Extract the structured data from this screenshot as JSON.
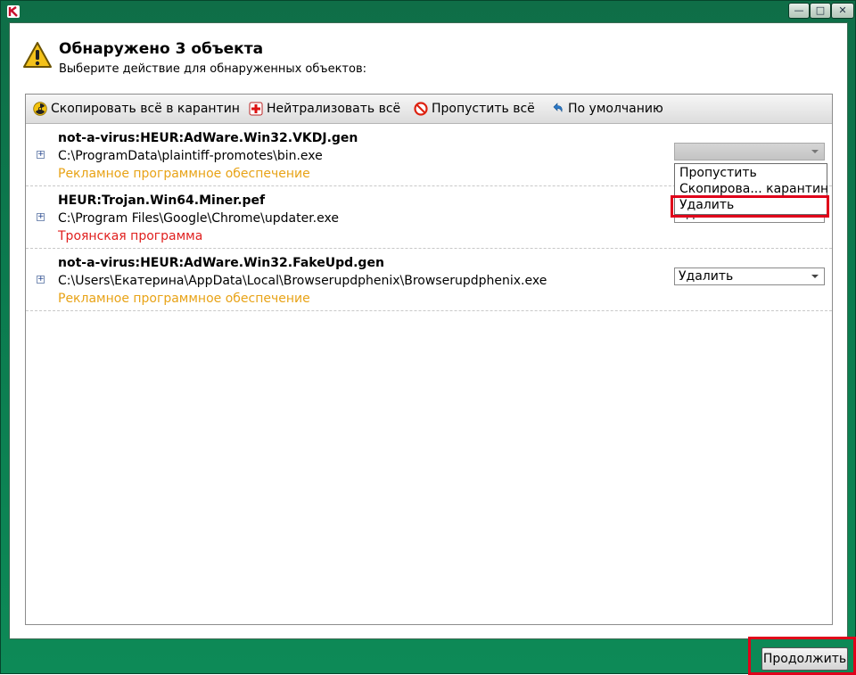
{
  "window": {
    "controls": {
      "minimize": "—",
      "maximize": "□",
      "close": "✕"
    }
  },
  "header": {
    "title": "Обнаружено 3 объекта",
    "subtitle": "Выберите действие для обнаруженных объектов:"
  },
  "toolbar": {
    "quarantine_all": "Скопировать всё в карантин",
    "disinfect_all": "Нейтрализовать всё",
    "skip_all": "Пропустить всё",
    "default": "По умолчанию"
  },
  "threats": [
    {
      "name": "not-a-virus:HEUR:AdWare.Win32.VKDJ.gen",
      "path": "C:\\ProgramData\\plaintiff-promotes\\bin.exe",
      "type": "Рекламное программное обеспечение",
      "action": ""
    },
    {
      "name": "HEUR:Trojan.Win64.Miner.pef",
      "path": "C:\\Program Files\\Google\\Chrome\\updater.exe",
      "type": "Троянская программа",
      "action": "Удалить"
    },
    {
      "name": "not-a-virus:HEUR:AdWare.Win32.FakeUpd.gen",
      "path": "C:\\Users\\Екатерина\\AppData\\Local\\Browserupdphenix\\Browserupdphenix.exe",
      "type": "Рекламное программное обеспечение",
      "action": "Удалить"
    }
  ],
  "dropdown": {
    "options": [
      "Пропустить",
      "Скопирова... карантин",
      "Удалить"
    ]
  },
  "footer": {
    "continue_label": "Продолжить"
  },
  "colors": {
    "frame": "#0b7a4e",
    "adware": "#e8a317",
    "trojan": "#e0201f",
    "annotation": "#e0001a"
  }
}
